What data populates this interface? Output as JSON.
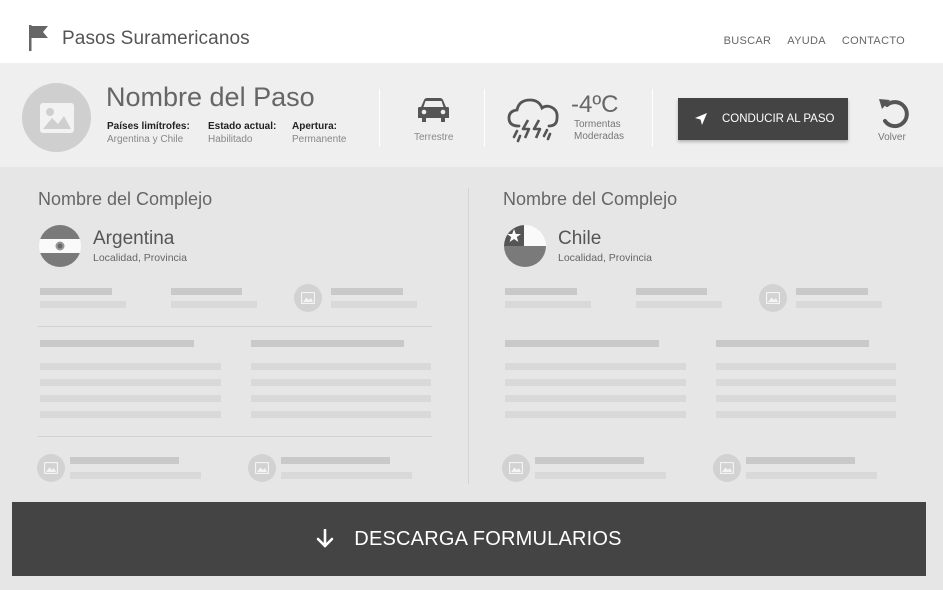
{
  "brand": {
    "name": "Pasos Suramericanos",
    "icon": "flag-icon"
  },
  "nav": {
    "items": [
      "BUSCAR",
      "AYUDA",
      "CONTACTO"
    ]
  },
  "pass": {
    "title": "Nombre del Paso",
    "meta": [
      {
        "label": "Países limítrofes:",
        "value": "Argentina y Chile"
      },
      {
        "label": "Estado actual:",
        "value": "Habilitado"
      },
      {
        "label": "Apertura:",
        "value": "Permanente"
      }
    ],
    "transport": {
      "label": "Terrestre",
      "icon": "car-icon"
    },
    "weather": {
      "temp": "-4ºC",
      "line1": "Tormentas",
      "line2": "Moderadas",
      "icon": "storm-cloud-icon"
    },
    "drive_button": "CONDUCIR AL PASO",
    "back_label": "Volver"
  },
  "complexes": [
    {
      "title": "Nombre del Complejo",
      "country": "Argentina",
      "locality": "Localidad, Provincia"
    },
    {
      "title": "Nombre del Complejo",
      "country": "Chile",
      "locality": "Localidad, Provincia"
    }
  ],
  "download": {
    "label": "DESCARGA FORMULARIOS",
    "icon": "arrow-down-icon"
  },
  "colors": {
    "dark_button": "#444444",
    "header_bg": "#efefef",
    "page_bg": "#e6e6e6"
  }
}
